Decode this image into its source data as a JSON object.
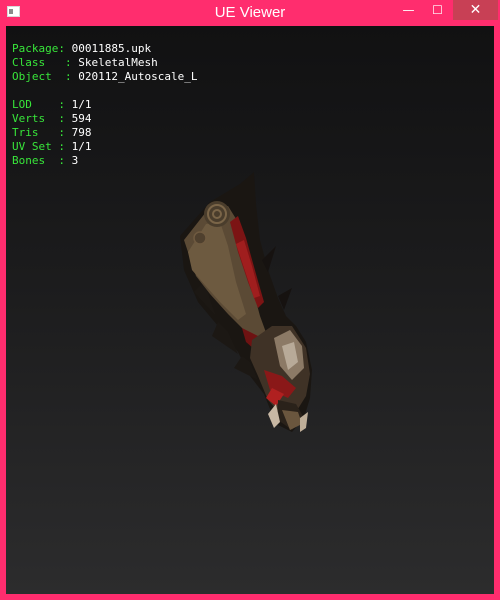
{
  "window": {
    "title": "UE Viewer",
    "controls": {
      "minimize": "—",
      "maximize": "☐",
      "close": "✕"
    }
  },
  "info": {
    "package_label": "Package",
    "package": "00011885.upk",
    "class_label": "Class",
    "class": "SkeletalMesh",
    "object_label": "Object",
    "object": "020112_Autoscale_L",
    "lod_label": "LOD",
    "lod": "1/1",
    "verts_label": "Verts",
    "verts": "594",
    "tris_label": "Tris",
    "tris": "798",
    "uvset_label": "UV Set",
    "uvset": "1/1",
    "bones_label": "Bones",
    "bones": "3"
  },
  "colors": {
    "window_border": "#ff2d6e",
    "label": "#38e63a",
    "value": "#ffffff",
    "viewport_top": "#111112",
    "viewport_bottom": "#2c2c2d"
  }
}
